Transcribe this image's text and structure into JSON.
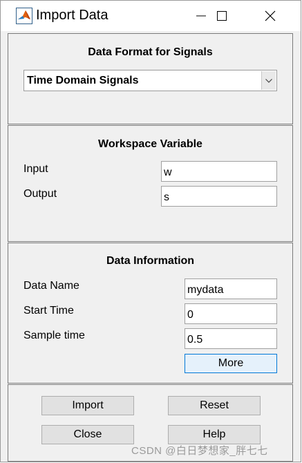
{
  "window": {
    "title": "Import Data"
  },
  "format_panel": {
    "title": "Data Format for Signals",
    "selected": "Time Domain Signals"
  },
  "workspace_panel": {
    "title": "Workspace Variable",
    "input_label": "Input",
    "input_value": "w",
    "output_label": "Output",
    "output_value": "s"
  },
  "info_panel": {
    "title": "Data Information",
    "data_name_label": "Data Name",
    "data_name_value": "mydata",
    "start_time_label": "Start Time",
    "start_time_value": "0",
    "sample_time_label": "Sample time",
    "sample_time_value": "0.5",
    "more_label": "More"
  },
  "buttons": {
    "import": "Import",
    "reset": "Reset",
    "close": "Close",
    "help": "Help"
  },
  "watermark": "CSDN @白日梦想家_胖七七",
  "colors": {
    "accent": "#0078d7",
    "panel_bg": "#f0f0f0",
    "button_bg": "#e1e1e1"
  },
  "icons": [
    "matlab-icon",
    "minimize-icon",
    "maximize-icon",
    "close-icon",
    "chevron-down-icon"
  ]
}
